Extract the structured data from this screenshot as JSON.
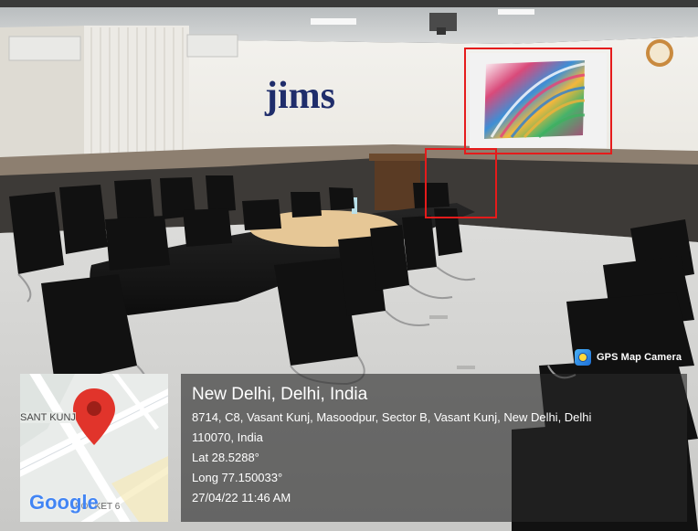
{
  "image": {
    "subject": "conference room photo",
    "wall_logo": "jims"
  },
  "overlay": {
    "app_badge": "GPS Map Camera",
    "map": {
      "area_label": "SANT KUNJ",
      "area_label_2": "POCKET 6",
      "provider_logo": "Google",
      "pin_icon": "location-pin-icon"
    },
    "location": {
      "title": "New Delhi, Delhi, India",
      "address_line1": "8714, C8, Vasant Kunj, Masoodpur, Sector B, Vasant Kunj, New Delhi, Delhi",
      "address_line2": "110070, India",
      "lat": "Lat 28.5288°",
      "long": "Long 77.150033°",
      "datetime": "27/04/22 11:46 AM"
    }
  },
  "colors": {
    "highlight_box": "#e51b1b",
    "pin": "#e1342b"
  }
}
